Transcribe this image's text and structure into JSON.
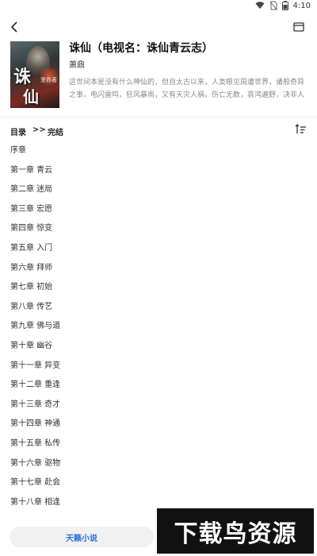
{
  "status_bar": {
    "time": "4:10",
    "icons": [
      "wifi-icon",
      "no-sim-icon",
      "battery-icon"
    ]
  },
  "top_bar": {
    "back_icon": "chevron-left-icon",
    "bookmark_icon": "bookmark-icon"
  },
  "book": {
    "title": "诛仙（电视名：诛仙青云志）",
    "author": "萧鼎",
    "description": "这世间本是没有什么神仙的，但自太古以来，人类眼见周遭世界，诸般奇异之事，电闪雷鸣，狂风暴雨，又有天灾人祸，伤亡无数，哀鸿遍野，决非人力所能为，所能抵挡。遂以为九天之上，有诸般神灵，九幽之下，…",
    "cover_text_1": "诛",
    "cover_text_2": "仙",
    "cover_author": "萧鼎著"
  },
  "toc": {
    "label": "目录",
    "separator": ">>",
    "status": "完结",
    "sort_icon": "sort-icon",
    "chapters": [
      "序章",
      "第一章 青云",
      "第二章 迷局",
      "第三章 宏愿",
      "第四章 惊变",
      "第五章 入门",
      "第六章 拜师",
      "第七章 初始",
      "第八章 传艺",
      "第九章 佛与道",
      "第十章 幽谷",
      "第十一章 异变",
      "第十二章 重逢",
      "第十三章 奇才",
      "第十四章 神通",
      "第十五章 私传",
      "第十六章 驱物",
      "第十七章 赴会",
      "第十八章 相逢"
    ]
  },
  "bottom": {
    "button_label": "天籁小说"
  },
  "watermark": {
    "text": "下载鸟资源"
  },
  "colors": {
    "accent": "#2f6fd6",
    "description": "#8a8a8a",
    "watermark_bg": "#111111"
  }
}
